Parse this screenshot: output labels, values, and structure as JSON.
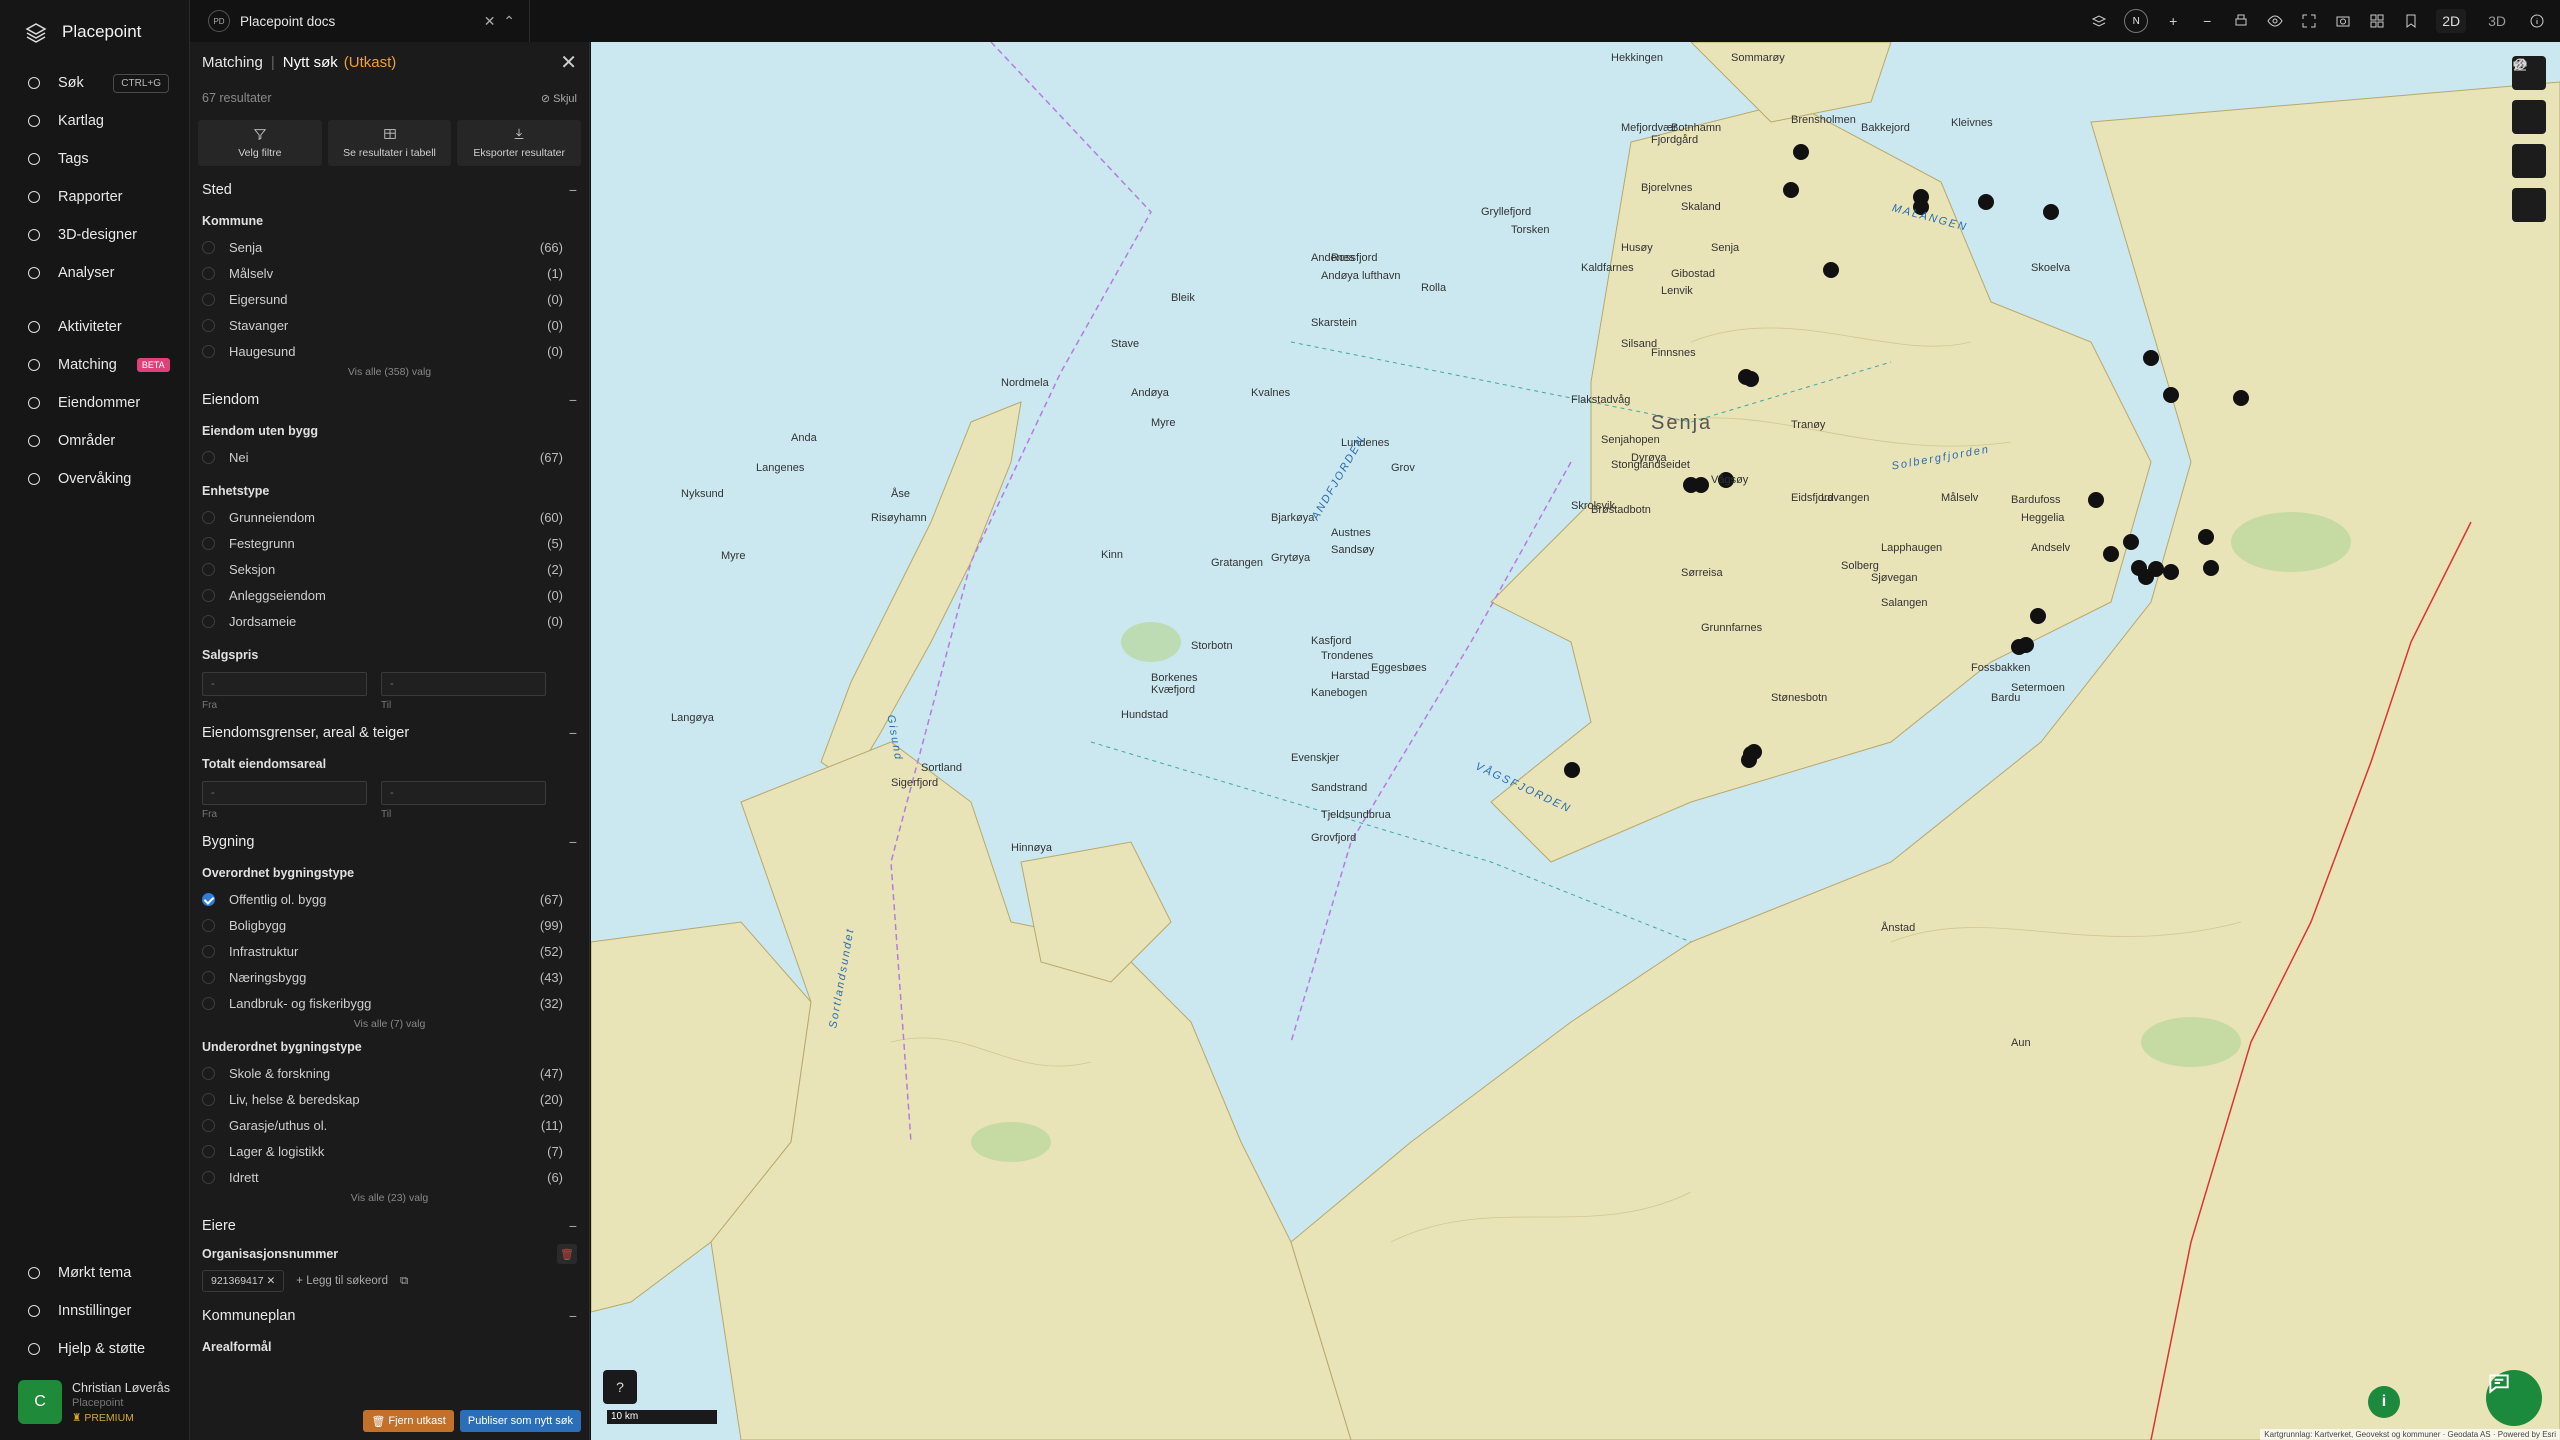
{
  "app": {
    "name": "Placepoint"
  },
  "nav": {
    "items": [
      {
        "label": "Søk",
        "icon": "search-icon",
        "kbd": "CTRL+G"
      },
      {
        "label": "Kartlag",
        "icon": "layers-icon"
      },
      {
        "label": "Tags",
        "icon": "bookmark-icon"
      },
      {
        "label": "Rapporter",
        "icon": "chart-icon"
      },
      {
        "label": "3D-designer",
        "icon": "cube-icon"
      },
      {
        "label": "Analyser",
        "icon": "bolt-icon"
      }
    ],
    "items2": [
      {
        "label": "Aktiviteter",
        "icon": "activity-icon"
      },
      {
        "label": "Matching",
        "icon": "target-icon",
        "badge": "BETA"
      },
      {
        "label": "Eiendommer",
        "icon": "building-icon"
      },
      {
        "label": "Områder",
        "icon": "area-icon"
      },
      {
        "label": "Overvåking",
        "icon": "monitor-icon"
      }
    ],
    "bottom": [
      {
        "label": "Mørkt tema",
        "icon": "moon-icon"
      },
      {
        "label": "Innstillinger",
        "icon": "gear-icon"
      },
      {
        "label": "Hjelp & støtte",
        "icon": "help-icon"
      }
    ],
    "user": {
      "initial": "C",
      "name": "Christian Løverås",
      "org": "Placepoint",
      "plan": "PREMIUM"
    }
  },
  "topbar": {
    "tab_badge": "PD",
    "tab_title": "Placepoint docs",
    "compass": "N",
    "dim_2d": "2D",
    "dim_3d": "3D"
  },
  "panel": {
    "crumb": "Matching",
    "title": "Nytt søk",
    "status": "(Utkast)",
    "results": "67 resultater",
    "hide": "Skjul",
    "actions": [
      "Velg filtre",
      "Se resultater i tabell",
      "Eksporter resultater"
    ],
    "sted": {
      "title": "Sted",
      "kommune_label": "Kommune",
      "kommune": [
        {
          "label": "Senja",
          "count": "(66)"
        },
        {
          "label": "Målselv",
          "count": "(1)"
        },
        {
          "label": "Eigersund",
          "count": "(0)"
        },
        {
          "label": "Stavanger",
          "count": "(0)"
        },
        {
          "label": "Haugesund",
          "count": "(0)"
        }
      ],
      "more": "Vis alle (358) valg"
    },
    "eiendom": {
      "title": "Eiendom",
      "uten_bygg_label": "Eiendom uten bygg",
      "uten_bygg": [
        {
          "label": "Nei",
          "count": "(67)"
        }
      ],
      "enhetstype_label": "Enhetstype",
      "enhetstype": [
        {
          "label": "Grunneiendom",
          "count": "(60)"
        },
        {
          "label": "Festegrunn",
          "count": "(5)"
        },
        {
          "label": "Seksjon",
          "count": "(2)"
        },
        {
          "label": "Anleggseiendom",
          "count": "(0)"
        },
        {
          "label": "Jordsameie",
          "count": "(0)"
        }
      ],
      "salgspris_label": "Salgspris",
      "fra": "Fra",
      "til": "Til",
      "dash": "-"
    },
    "grenser": {
      "title": "Eiendomsgrenser, areal & teiger",
      "areal_label": "Totalt eiendomsareal",
      "fra": "Fra",
      "til": "Til",
      "dash": "-"
    },
    "bygning": {
      "title": "Bygning",
      "over_label": "Overordnet bygningstype",
      "over": [
        {
          "label": "Offentlig ol. bygg",
          "count": "(67)",
          "checked": true
        },
        {
          "label": "Boligbygg",
          "count": "(99)"
        },
        {
          "label": "Infrastruktur",
          "count": "(52)"
        },
        {
          "label": "Næringsbygg",
          "count": "(43)"
        },
        {
          "label": "Landbruk- og fiskeribygg",
          "count": "(32)"
        }
      ],
      "over_more": "Vis alle (7) valg",
      "under_label": "Underordnet bygningstype",
      "under": [
        {
          "label": "Skole & forskning",
          "count": "(47)"
        },
        {
          "label": "Liv, helse & beredskap",
          "count": "(20)"
        },
        {
          "label": "Garasje/uthus ol.",
          "count": "(11)"
        },
        {
          "label": "Lager & logistikk",
          "count": "(7)"
        },
        {
          "label": "Idrett",
          "count": "(6)"
        }
      ],
      "under_more": "Vis alle (23) valg"
    },
    "eiere": {
      "title": "Eiere",
      "org_label": "Organisasjonsnummer",
      "chip": "921369417",
      "add": "Legg til søkeord"
    },
    "kommuneplan": {
      "title": "Kommuneplan",
      "areal_label": "Arealformål"
    },
    "footer": {
      "remove": "Fjern utkast",
      "publish": "Publiser som nytt søk"
    }
  },
  "map": {
    "scale": "10 km",
    "attribution": "Kartgrunnlag: Kartverket, Geovekst og kommuner · Geodata AS · Powered by Esri",
    "labels": [
      {
        "t": "Andenes"
      },
      {
        "t": "Andøya lufthavn"
      },
      {
        "t": "Bleik"
      },
      {
        "t": "Skarstein"
      },
      {
        "t": "Stave"
      },
      {
        "t": "Nordmela"
      },
      {
        "t": "Andøya"
      },
      {
        "t": "Kvalnes"
      },
      {
        "t": "Myre"
      },
      {
        "t": "Anda"
      },
      {
        "t": "Langenes"
      },
      {
        "t": "Nyksund"
      },
      {
        "t": "Risøyhamn"
      },
      {
        "t": "Åse"
      },
      {
        "t": "Myre"
      },
      {
        "t": "Bjarkøya"
      },
      {
        "t": "Grytøya"
      },
      {
        "t": "Kinn"
      },
      {
        "t": "Gratangen"
      },
      {
        "t": "Austnes"
      },
      {
        "t": "Sandsøy"
      },
      {
        "t": "Harstad"
      },
      {
        "t": "Kasfjord"
      },
      {
        "t": "Storbotn"
      },
      {
        "t": "Borkenes"
      },
      {
        "t": "Kvæfjord"
      },
      {
        "t": "Hundstad"
      },
      {
        "t": "Sortland"
      },
      {
        "t": "Langøya"
      },
      {
        "t": "Sigerfjord"
      },
      {
        "t": "Hinnøya"
      },
      {
        "t": "Trondenes"
      },
      {
        "t": "Kanebogen"
      },
      {
        "t": "Tjeldsundbrua"
      },
      {
        "t": "Evenskjer"
      },
      {
        "t": "Sandstrand"
      },
      {
        "t": "Grovfjord"
      },
      {
        "t": "Senja"
      },
      {
        "t": "Finnsnes"
      },
      {
        "t": "Silsand"
      },
      {
        "t": "Gibostad"
      },
      {
        "t": "Lenvik"
      },
      {
        "t": "Gryllefjord"
      },
      {
        "t": "Torsken"
      },
      {
        "t": "Husøy"
      },
      {
        "t": "Skaland"
      },
      {
        "t": "Mefjordvær"
      },
      {
        "t": "Botnhamn"
      },
      {
        "t": "Fjordgård"
      },
      {
        "t": "Bjorelvnes"
      },
      {
        "t": "Hekkingen"
      },
      {
        "t": "Sommarøy"
      },
      {
        "t": "Brensholmen"
      },
      {
        "t": "Bakkejord"
      },
      {
        "t": "Kleivnes"
      },
      {
        "t": "Senjahopen"
      },
      {
        "t": "Stonglandseidet"
      },
      {
        "t": "Vågsøy"
      },
      {
        "t": "Dyrøya"
      },
      {
        "t": "Brøstadbotn"
      },
      {
        "t": "Sørreisa"
      },
      {
        "t": "Solberg"
      },
      {
        "t": "Lavangen"
      },
      {
        "t": "Sjøvegan"
      },
      {
        "t": "Salangen"
      },
      {
        "t": "Bardu"
      },
      {
        "t": "Setermoen"
      },
      {
        "t": "Målselv"
      },
      {
        "t": "Bardufoss"
      },
      {
        "t": "Heggelia"
      },
      {
        "t": "Andselv"
      },
      {
        "t": "Tranøy"
      },
      {
        "t": "Skrolsvik"
      },
      {
        "t": "Flakstadvåg"
      },
      {
        "t": "Kaldfarnes"
      },
      {
        "t": "Grunnfarnes"
      },
      {
        "t": "Stønesbotn"
      },
      {
        "t": "Ånstad"
      },
      {
        "t": "Aun"
      },
      {
        "t": "Eggesbøes"
      },
      {
        "t": "Eidsfjord"
      },
      {
        "t": "Lundenes"
      },
      {
        "t": "Rolla"
      },
      {
        "t": "Grov"
      },
      {
        "t": "Fossbakken"
      },
      {
        "t": "Lapphaugen"
      },
      {
        "t": "Skoelva"
      },
      {
        "t": "Rossfjord"
      }
    ],
    "water": [
      "ANDFJORDEN",
      "VÅGSFJORDEN",
      "MALANGEN",
      "Solbergfjorden",
      "Gisund",
      "Sortlandsundet"
    ],
    "region": "Senja"
  }
}
